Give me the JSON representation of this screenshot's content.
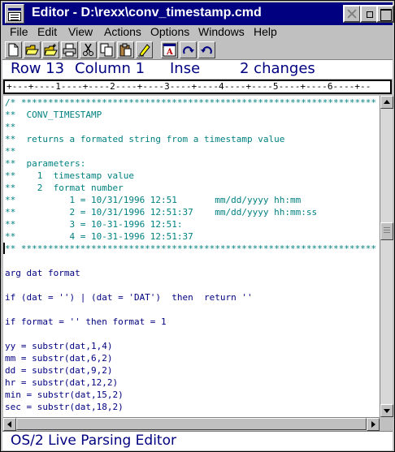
{
  "window": {
    "title": "Editor - D:\\rexx\\conv_timestamp.cmd"
  },
  "menubar": {
    "items": [
      "File",
      "Edit",
      "View",
      "Actions",
      "Options",
      "Windows",
      "Help"
    ]
  },
  "toolbar": {
    "tools": [
      "new-file-icon",
      "open-folder-icon",
      "open-folder-plus-icon",
      "print-icon",
      "cut-icon",
      "copy-icon",
      "paste-icon",
      "font-icon",
      "redo-icon",
      "undo-icon"
    ]
  },
  "status": {
    "row": "Row 13",
    "column": "Column 1",
    "mode": "Inse",
    "changes": "2 changes"
  },
  "ruler": {
    "text": "+---+----1----+----2----+----3----+----4----+----5----+----6----+--"
  },
  "editor": {
    "lines": [
      {
        "text": "/* ******************************************************************",
        "style": "comment"
      },
      {
        "text": "**  CONV_TIMESTAMP",
        "style": "comment"
      },
      {
        "text": "**",
        "style": "comment"
      },
      {
        "text": "**  returns a formated string from a timestamp value",
        "style": "comment"
      },
      {
        "text": "**",
        "style": "comment"
      },
      {
        "text": "**  parameters:",
        "style": "comment"
      },
      {
        "text": "**    1  timestamp value",
        "style": "comment"
      },
      {
        "text": "**    2  format number",
        "style": "comment"
      },
      {
        "text": "**          1 = 10/31/1996 12:51       mm/dd/yyyy hh:mm",
        "style": "comment"
      },
      {
        "text": "**          2 = 10/31/1996 12:51:37    mm/dd/yyyy hh:mm:ss",
        "style": "comment"
      },
      {
        "text": "**          3 = 10-31-1996 12:51:",
        "style": "comment"
      },
      {
        "text": "**          4 = 10-31-1996 12:51:37",
        "style": "comment"
      },
      {
        "text": "** ******************************************************************",
        "style": "comment"
      },
      {
        "text": "",
        "style": "normal"
      },
      {
        "text": "arg dat format",
        "style": "normal"
      },
      {
        "text": "",
        "style": "normal"
      },
      {
        "text": "if (dat = '') | (dat = 'DAT')  then  return ''",
        "style": "normal"
      },
      {
        "text": "",
        "style": "normal"
      },
      {
        "text": "if format = '' then format = 1",
        "style": "normal"
      },
      {
        "text": "",
        "style": "normal"
      },
      {
        "text": "yy = substr(dat,1,4)",
        "style": "normal"
      },
      {
        "text": "mm = substr(dat,6,2)",
        "style": "normal"
      },
      {
        "text": "dd = substr(dat,9,2)",
        "style": "normal"
      },
      {
        "text": "hr = substr(dat,12,2)",
        "style": "normal"
      },
      {
        "text": "min = substr(dat,15,2)",
        "style": "normal"
      },
      {
        "text": "sec = substr(dat,18,2)",
        "style": "normal"
      }
    ]
  },
  "message_line": {
    "text": "OS/2 Live Parsing Editor"
  },
  "colors": {
    "titlebar": "#000080",
    "comment_text": "#008080",
    "code_text": "#000080",
    "status_text": "#000080",
    "chrome": "#c0c0c0"
  }
}
